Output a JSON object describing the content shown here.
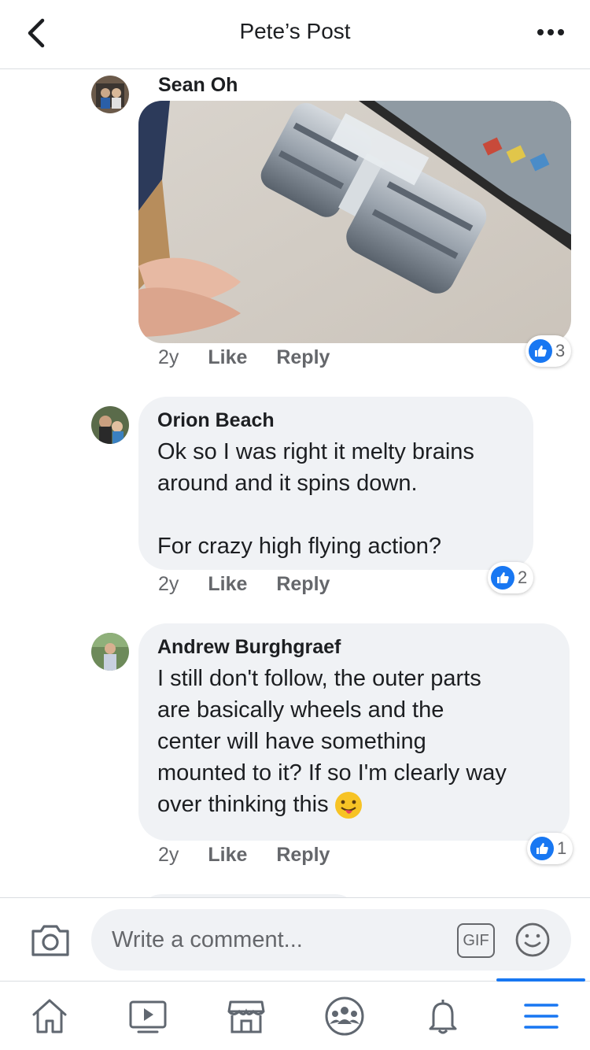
{
  "header": {
    "title": "Pete’s Post"
  },
  "comments": [
    {
      "author": "Sean Oh",
      "age": "2y",
      "like": "Like",
      "reply": "Reply",
      "reactions": "3"
    },
    {
      "author": "Orion Beach",
      "text": "Ok so I was right it melty brains\naround and it spins down.\n\nFor crazy high flying action?",
      "age": "2y",
      "like": "Like",
      "reply": "Reply",
      "reactions": "2"
    },
    {
      "author": "Andrew Burghgraef",
      "text": "I still don't follow, the outer parts\nare basically wheels and the\ncenter will have something\nmounted to it? If so I'm clearly way\nover thinking this",
      "age": "2y",
      "like": "Like",
      "reply": "Reply",
      "reactions": "1"
    }
  ],
  "composer": {
    "placeholder": "Write a comment...",
    "gif_label": "GIF"
  },
  "colors": {
    "accent": "#1877f2",
    "bubble": "#f0f2f5",
    "muted": "#65676b"
  },
  "icons": {
    "header": [
      "back-chevron-icon",
      "more-icon"
    ],
    "composer": [
      "camera-icon",
      "gif-icon",
      "emoji-icon"
    ],
    "nav": [
      "home-icon",
      "video-icon",
      "marketplace-icon",
      "groups-icon",
      "notifications-icon",
      "menu-icon"
    ]
  }
}
